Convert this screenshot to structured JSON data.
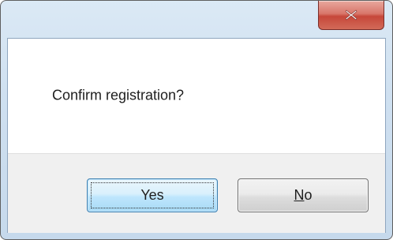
{
  "dialog": {
    "message": "Confirm registration?",
    "buttons": {
      "yes_label": "Yes",
      "no_label": "No",
      "no_mnemonic": "N",
      "no_rest": "o"
    },
    "close_icon": "close-icon"
  }
}
